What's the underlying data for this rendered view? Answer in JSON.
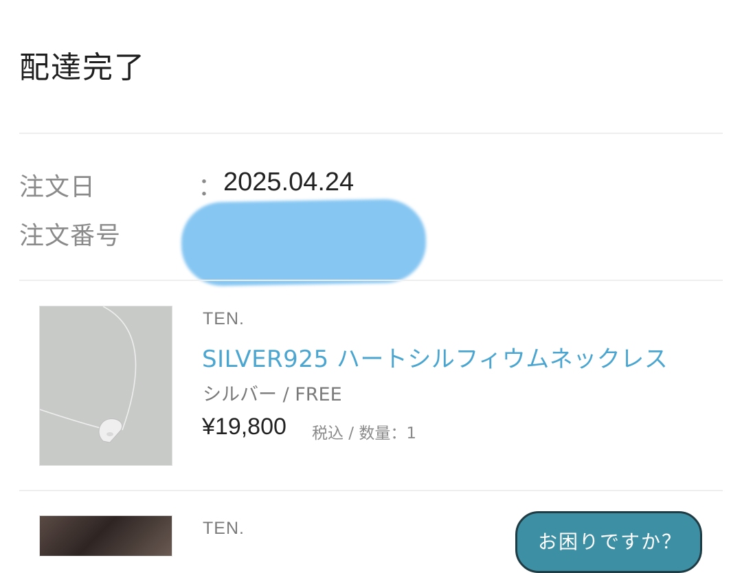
{
  "order": {
    "status_title": "配達完了",
    "date_label": "注文日",
    "colon": "：",
    "date_value": "2025.04.24",
    "number_label": "注文番号"
  },
  "items": [
    {
      "brand": "TEN.",
      "name": "SILVER925 ハートシルフィウムネックレス",
      "variant": "シルバー / FREE",
      "price": "¥19,800",
      "price_note": "税込 / 数量：1"
    },
    {
      "brand": "TEN."
    }
  ],
  "help": {
    "label": "お困りですか？"
  },
  "colors": {
    "accent": "#4aa6d0",
    "help_button": "#3d8fa4",
    "redaction": "#86c6f2"
  }
}
